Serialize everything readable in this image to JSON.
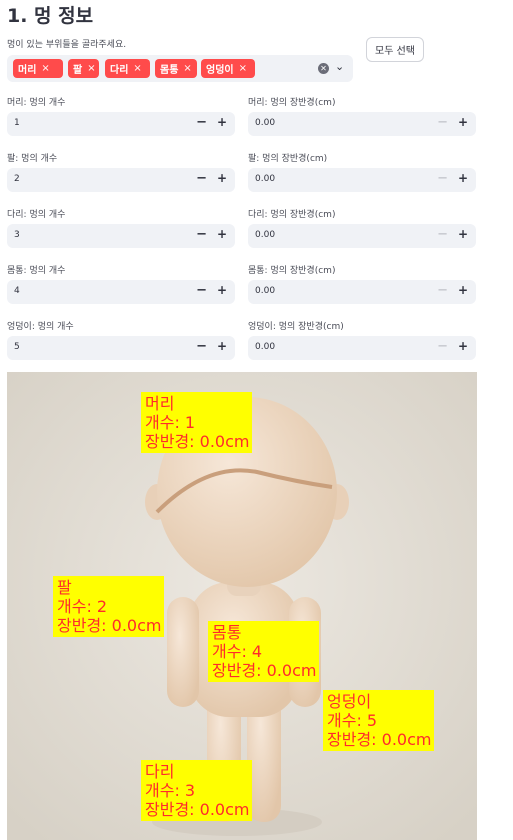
{
  "title": "1. 멍 정보",
  "select_prompt": "멍이 있는 부위들을 골라주세요.",
  "selected_parts": [
    "머리",
    "팔",
    "다리",
    "몸통",
    "엉덩이"
  ],
  "tag_remove": "×",
  "icons": {
    "clear": "clear-x-icon",
    "dropdown": "chevron-down-icon",
    "minus": "minus-icon",
    "plus": "plus-icon"
  },
  "select_all_label": "모두 선택",
  "stepper": {
    "minus": "−",
    "plus": "+"
  },
  "rows": [
    {
      "count_label": "머리: 멍의 개수",
      "count_value": "1",
      "diam_label": "머리: 멍의 장반경(cm)",
      "diam_value": "0.00"
    },
    {
      "count_label": "팔: 멍의 개수",
      "count_value": "2",
      "diam_label": "팔: 멍의 장반경(cm)",
      "diam_value": "0.00"
    },
    {
      "count_label": "다리: 멍의 개수",
      "count_value": "3",
      "diam_label": "다리: 멍의 장반경(cm)",
      "diam_value": "0.00"
    },
    {
      "count_label": "몸통: 멍의 개수",
      "count_value": "4",
      "diam_label": "몸통: 멍의 장반경(cm)",
      "diam_value": "0.00"
    },
    {
      "count_label": "엉덩이: 멍의 개수",
      "count_value": "5",
      "diam_label": "엉덩이: 멍의 장반경(cm)",
      "diam_value": "0.00"
    }
  ],
  "annotations": [
    {
      "part": "머리",
      "count": "개수: 1",
      "diam": "장반경: 0.0cm"
    },
    {
      "part": "팔",
      "count": "개수: 2",
      "diam": "장반경: 0.0cm"
    },
    {
      "part": "몸통",
      "count": "개수: 4",
      "diam": "장반경: 0.0cm"
    },
    {
      "part": "엉덩이",
      "count": "개수: 5",
      "diam": "장반경: 0.0cm"
    },
    {
      "part": "다리",
      "count": "개수: 3",
      "diam": "장반경: 0.0cm"
    }
  ],
  "colors": {
    "accent": "#ff4b4b",
    "label_bg": "#ffff00",
    "label_text": "#ff2b2b"
  }
}
